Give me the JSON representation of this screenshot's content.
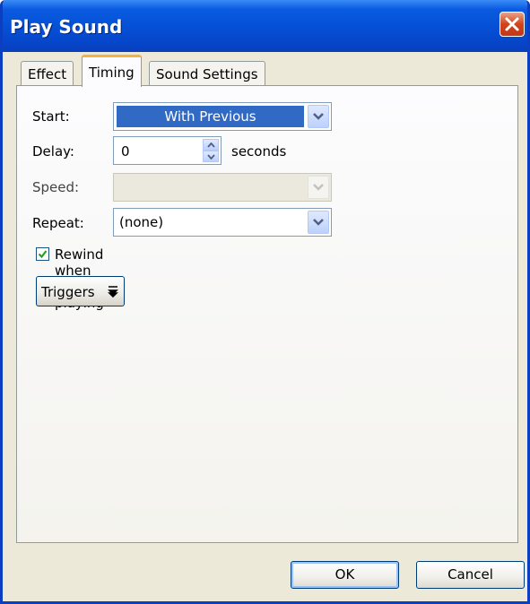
{
  "window": {
    "title": "Play Sound"
  },
  "tabs": [
    {
      "label": "Effect",
      "active": false
    },
    {
      "label": "Timing",
      "active": true
    },
    {
      "label": "Sound Settings",
      "active": false
    }
  ],
  "timing": {
    "start": {
      "label": "Start:",
      "value": "With Previous"
    },
    "delay": {
      "label": "Delay:",
      "value": "0",
      "unit": "seconds"
    },
    "speed": {
      "label": "Speed:",
      "value": "",
      "disabled": true
    },
    "repeat": {
      "label": "Repeat:",
      "value": "(none)"
    },
    "rewind": {
      "label": "Rewind when done playing",
      "checked": true
    },
    "triggers_label": "Triggers"
  },
  "buttons": {
    "ok": "OK",
    "cancel": "Cancel"
  },
  "colors": {
    "titlebar": "#0551d6",
    "selection": "#316ac5",
    "tab_highlight": "#f3b33d",
    "check": "#21a121"
  },
  "icons": [
    "close-icon",
    "combo-arrow-icon",
    "spin-up-icon",
    "spin-down-icon",
    "check-icon",
    "double-chevron-down-icon"
  ]
}
